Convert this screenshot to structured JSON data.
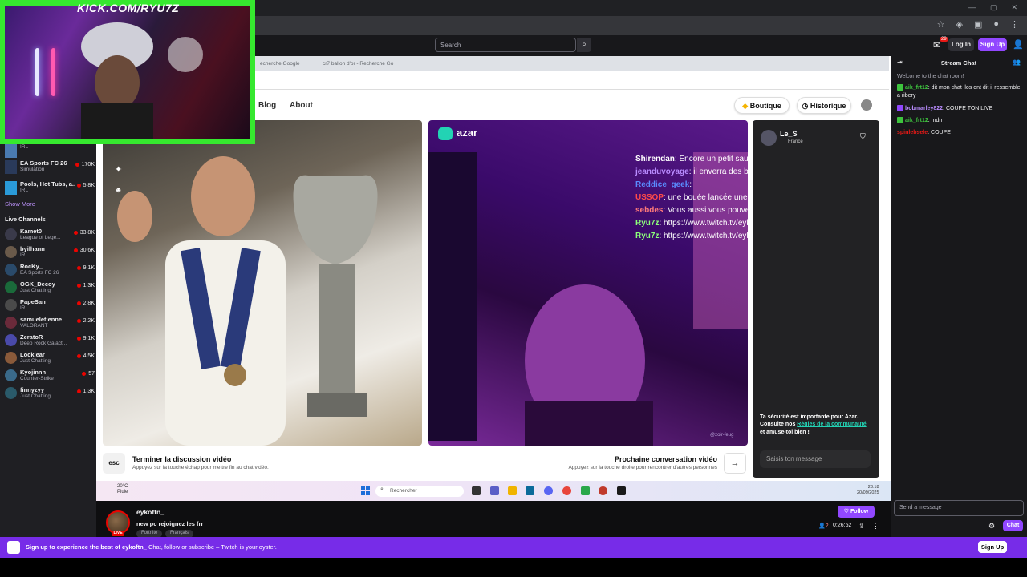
{
  "webcam": {
    "label": "KICK.COM/RYU7Z"
  },
  "twitch_nav": {
    "search_placeholder": "Search",
    "notif_count": "29",
    "login_label": "Log In",
    "signup_label": "Sign Up"
  },
  "sidebar": {
    "recommended": [
      {
        "name": "",
        "category": "IRL",
        "count": ""
      },
      {
        "name": "EA Sports FC 26",
        "category": "Simulation",
        "count": "170K"
      },
      {
        "name": "Pools, Hot Tubs, a...",
        "category": "IRL",
        "count": "5.8K"
      }
    ],
    "show_more": "Show More",
    "live_title": "Live Channels",
    "live": [
      {
        "name": "Kamet0",
        "category": "League of Lege...",
        "count": "33.8K"
      },
      {
        "name": "byilhann",
        "category": "IRL",
        "count": "30.6K"
      },
      {
        "name": "RocKy_",
        "category": "EA Sports FC 26",
        "count": "9.1K"
      },
      {
        "name": "OGK_Decoy",
        "category": "Just Chatting",
        "count": "1.3K"
      },
      {
        "name": "PapeSan",
        "category": "IRL",
        "count": "2.8K"
      },
      {
        "name": "samueletienne",
        "category": "VALORANT",
        "count": "2.2K"
      },
      {
        "name": "ZeratoR",
        "category": "Deep Rock Galact...",
        "count": "9.1K"
      },
      {
        "name": "Locklear",
        "category": "Just Chatting",
        "count": "4.5K"
      },
      {
        "name": "Kyojinnn",
        "category": "Counter-Strike",
        "count": "57"
      },
      {
        "name": "finnyzyy",
        "category": "Just Chatting",
        "count": "1.3K"
      }
    ]
  },
  "browser": {
    "tabs": [
      "echerche Google",
      "cr7 ballon d'or - Recherche Go"
    ]
  },
  "azar": {
    "logo": "azar",
    "nav_blog": "Blog",
    "nav_about": "About",
    "boutique": "Boutique",
    "historique": "Historique",
    "partner_name": "Le_S",
    "partner_country": "France",
    "overlay_chat": [
      {
        "user": "Shirendan",
        "text": ": Encore un petit sauvé",
        "color": "#ffffff"
      },
      {
        "user": "jeanduvoyage",
        "text": ": il enverra des bip bip qui sait",
        "color": "#b98cff"
      },
      {
        "user": "Reddice_geek",
        "text": ":",
        "color": "#5a8cff"
      },
      {
        "user": "USSOP",
        "text": ": une bouée lancée une perche tendue",
        "color": "#ff4a4a"
      },
      {
        "user": "sebdes",
        "text": ": Vous aussi vous pouvez changer le monde!",
        "color": "#ff7a7a"
      },
      {
        "user": "Ryu7z",
        "text": ": https://www.twitch.tv/eykoftn_",
        "color": "#8cff7a"
      },
      {
        "user": "Ryu7z",
        "text": ": https://www.twitch.tv/eykoftn_",
        "color": "#8cff7a"
      }
    ],
    "end_key": "esc",
    "end_title": "Terminer la discussion vidéo",
    "end_sub": "Appuyez sur la touche échap pour mettre fin au chat vidéo.",
    "next_title": "Prochaine conversation vidéo",
    "next_sub": "Appuyez sur la touche droite pour rencontrer d'autres personnes",
    "safety_a": "Ta sécurité est importante pour Azar. Consulte nos ",
    "safety_link": "Règles de la communauté",
    "safety_b": " et amuse-toi bien !",
    "input_placeholder": "Saisis ton message",
    "video_watermark": "@zoir-feug"
  },
  "taskbar": {
    "temp": "20°C",
    "weather": "Pluie",
    "search": "Rechercher",
    "time": "23:18",
    "date": "20/09/2025"
  },
  "stream": {
    "streamer": "eykoftn_",
    "title": "new pc rejoignez les frr",
    "tags": [
      "Fortnite",
      "Français"
    ],
    "live_badge": "LIVE",
    "follow": "Follow",
    "viewers": "2",
    "uptime": "0:26:52"
  },
  "chat": {
    "title": "Stream Chat",
    "welcome": "Welcome to the chat room!",
    "messages": [
      {
        "user": "aik_frt12",
        "text": ": dit mon chat ilos ont dit il ressemble a ribery",
        "color": "#3ec43e",
        "badge": "#3ec43e"
      },
      {
        "user": "bobmarley822",
        "text": ": COUPE TON LIVE",
        "color": "#b98cff",
        "badge": "#9147ff"
      },
      {
        "user": "aik_frt12",
        "text": ": mdrr",
        "color": "#3ec43e",
        "badge": "#3ec43e"
      },
      {
        "user": "spinlebsele",
        "text": ": COUPE",
        "color": "#e91916",
        "badge": ""
      }
    ],
    "input_placeholder": "Send a message",
    "chat_btn": "Chat"
  },
  "banner": {
    "text_bold": "Sign up to experience the best of eykoftn_",
    "text_rest": "  Chat, follow or subscribe – Twitch is your oyster.",
    "signup": "Sign Up"
  }
}
